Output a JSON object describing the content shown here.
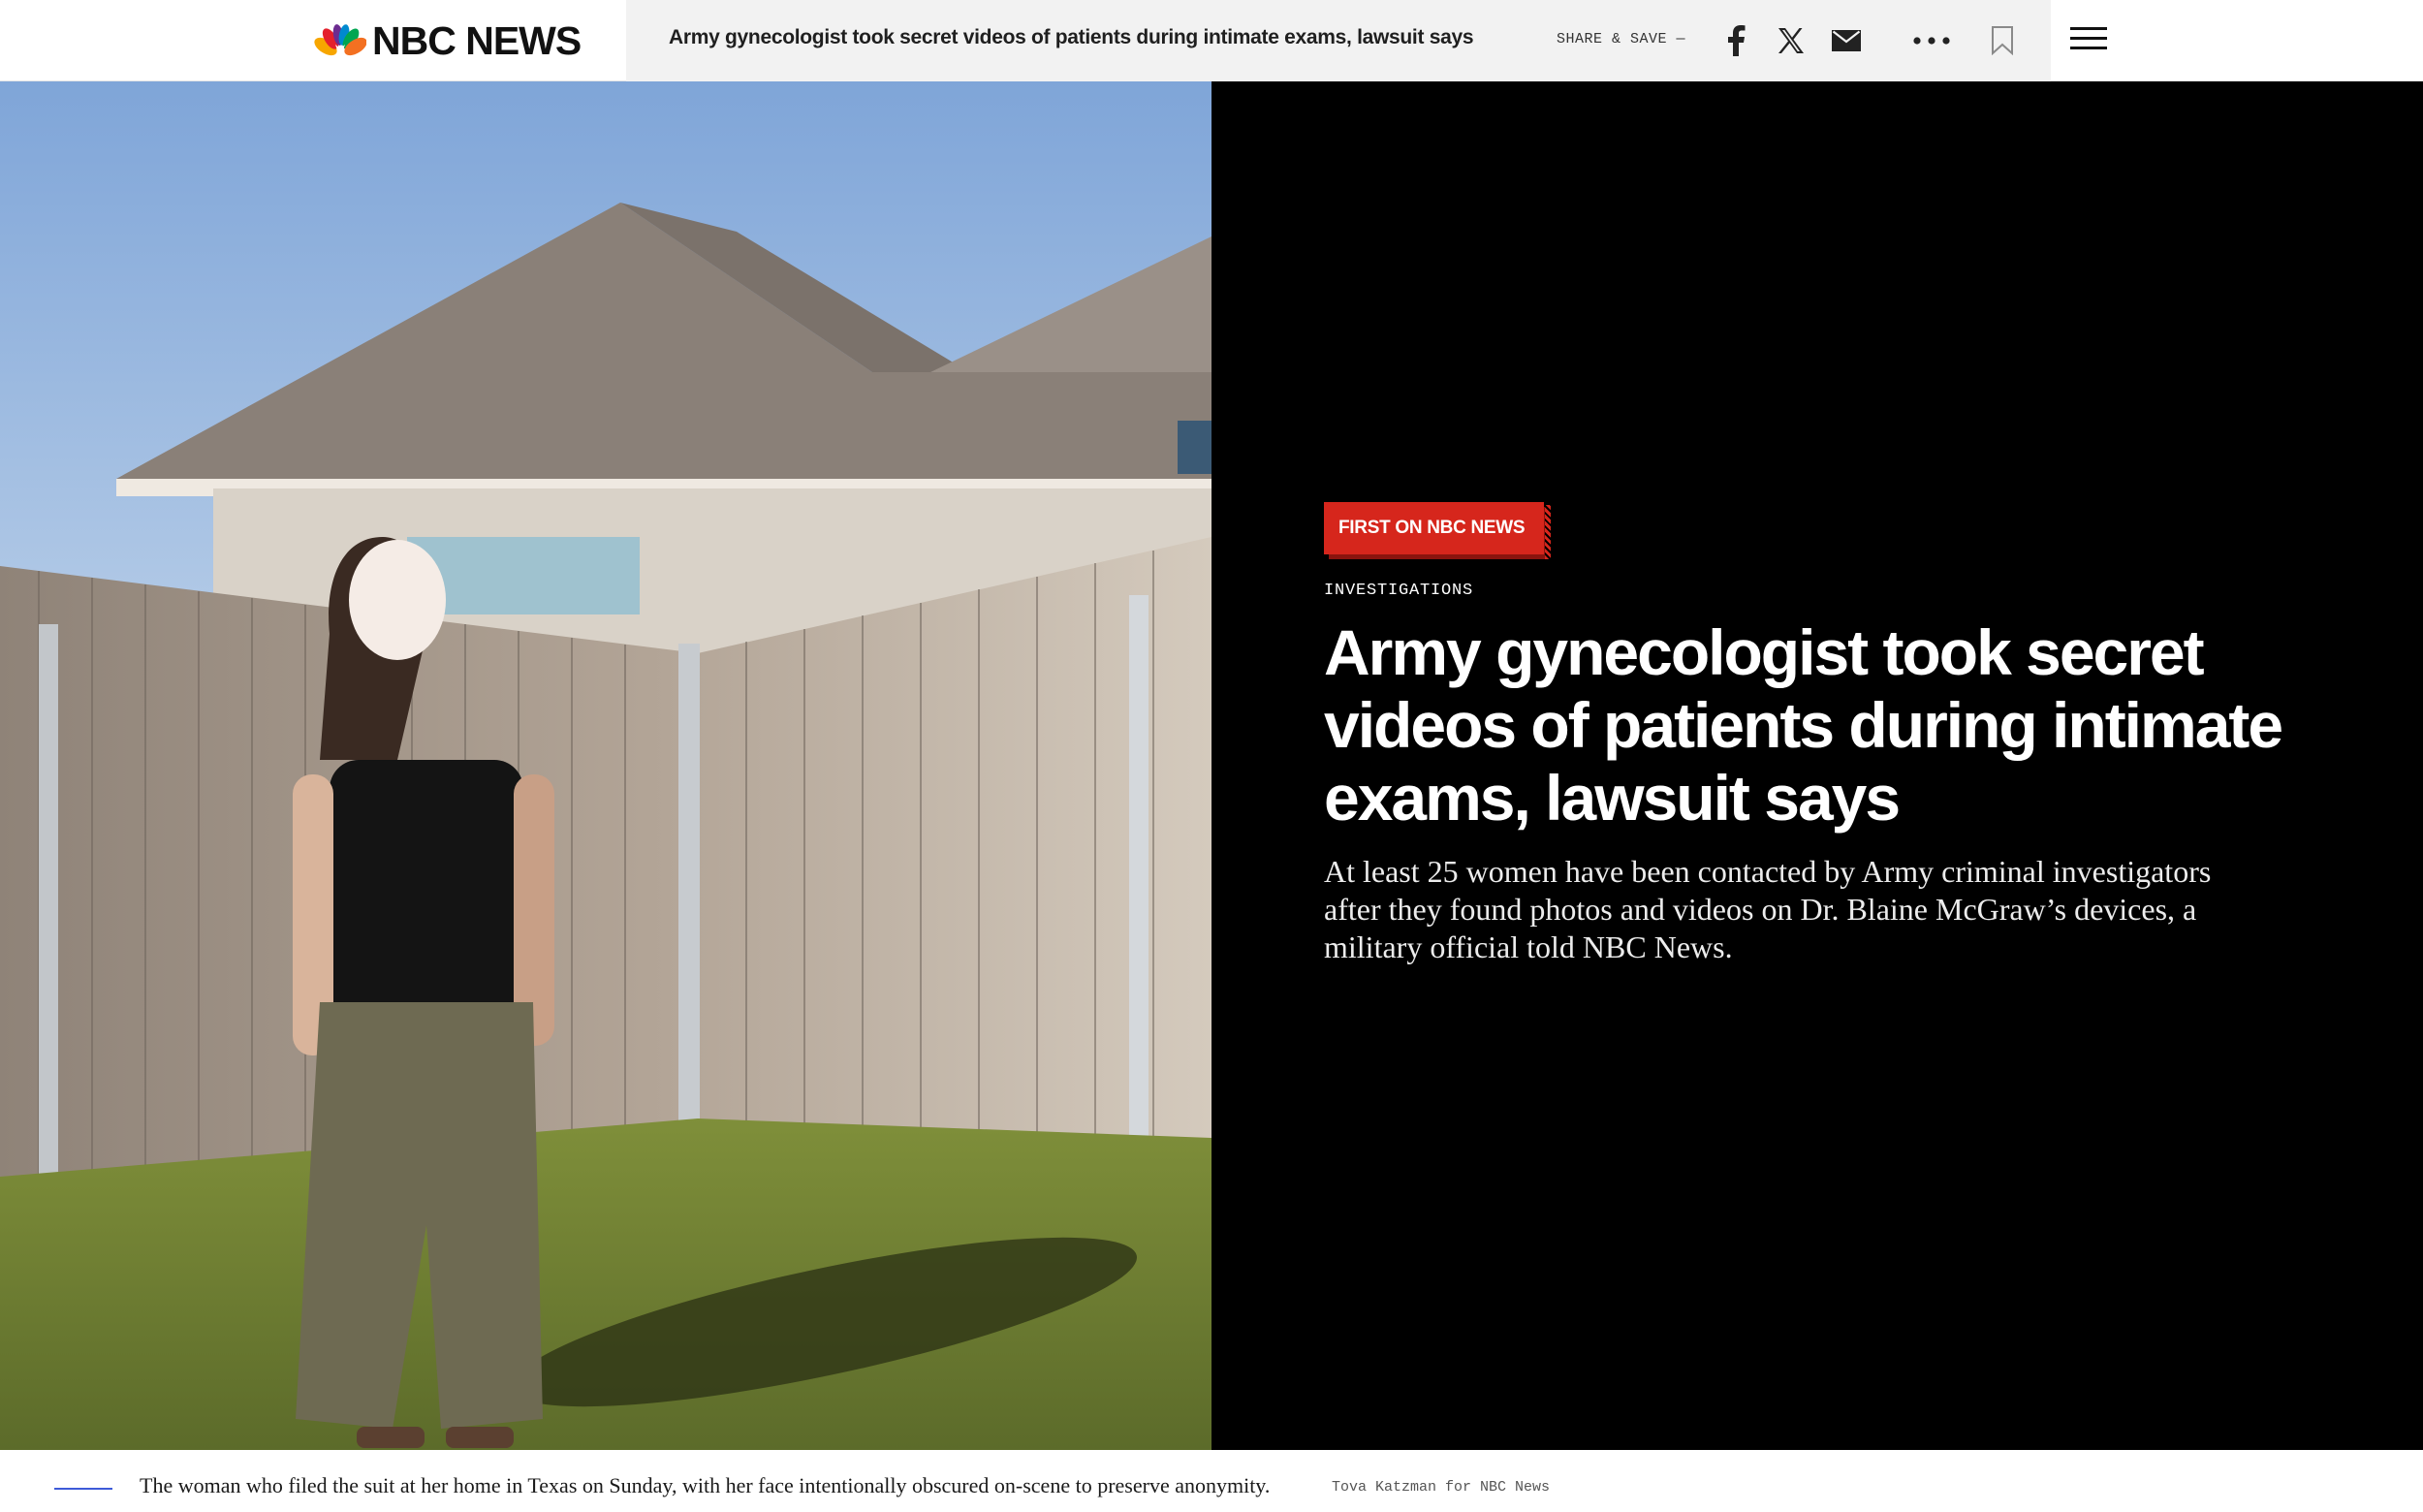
{
  "header": {
    "logo_text": "NBC NEWS",
    "article_title": "Army gynecologist took secret videos of patients during intimate exams, lawsuit says",
    "share_label": "SHARE & SAVE —",
    "icons": [
      "facebook-icon",
      "x-icon",
      "email-icon",
      "more-icon",
      "bookmark-icon",
      "menu-icon"
    ]
  },
  "hero": {
    "badge": "FIRST ON NBC NEWS",
    "category": "INVESTIGATIONS",
    "title": "Army gynecologist took secret videos of patients during intimate exams, lawsuit says",
    "dek": "At least 25 women have been contacted by Army criminal investigators after they found photos and videos on Dr. Blaine McGraw’s devices, a military official told NBC News."
  },
  "caption": {
    "text": "The woman who filed the suit at her home in Texas on Sunday, with her face intentionally obscured on-scene to preserve anonymity.",
    "credit": "Tova Katzman for NBC News"
  },
  "colors": {
    "brand_red": "#d6261c",
    "hero_bg": "#000000",
    "caption_rule": "#3e5bd8"
  }
}
